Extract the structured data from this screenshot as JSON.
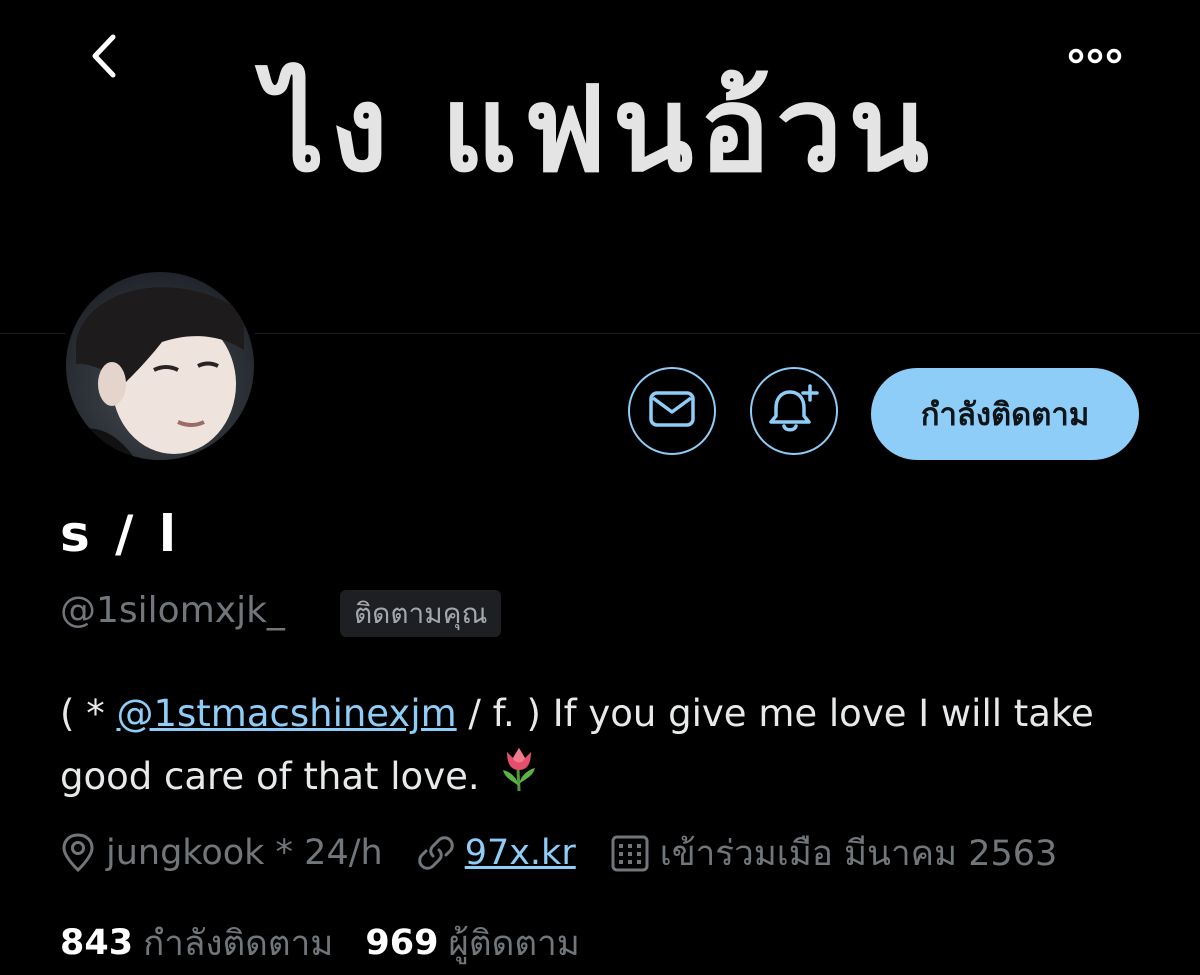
{
  "header": {
    "banner_title": "ไง แฟนอ้วน",
    "back_icon": "chevron-left-icon",
    "more_icon": "ellipsis-icon"
  },
  "profile": {
    "display_name": "s / l",
    "handle": "@1silomxjk_",
    "follows_you_badge": "ติดตามคุณ",
    "bio": {
      "prefix": "( * ",
      "mention": "@1stmacshinexjm",
      "suffix": " / f. ) If you give me love I will take good care of that love.",
      "emoji_icon": "tulip-icon"
    },
    "location": "jungkook * 24/h",
    "website": "97x.kr",
    "joined": "เข้าร่วมเมือ มีนาคม 2563",
    "following_count": "843",
    "following_label": "กำลังติดตาม",
    "followers_count": "969",
    "followers_label": "ผู้ติดตาม"
  },
  "actions": {
    "message_icon": "envelope-icon",
    "notify_icon": "bell-plus-icon",
    "follow_state_label": "กำลังติดตาม"
  },
  "colors": {
    "background": "#000000",
    "accent": "#8ecdf7",
    "secondary_text": "#71767b",
    "primary_text": "#e7e9ea"
  }
}
